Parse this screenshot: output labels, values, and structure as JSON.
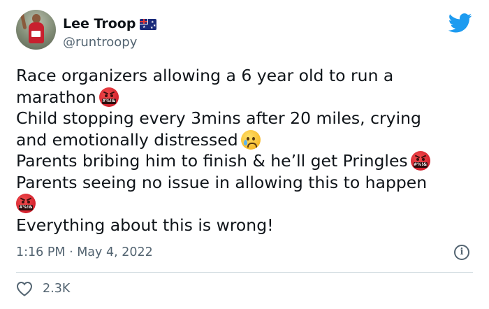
{
  "author": {
    "display_name": "Lee Troop",
    "handle": "@runtroopy",
    "avatar_icon": "runner-photo",
    "badge_icon": "australia-flag-icon"
  },
  "brand_icon": "twitter-bird-icon",
  "brand_color": "#1d9bf0",
  "tweet": {
    "lines": [
      "Race organizers allowing a 6 year old to run a",
      "marathon",
      "Child stopping every 3mins after 20 miles, crying",
      "and emotionally distressed",
      "Parents bribing him to finish & he’ll get Pringles",
      "Parents seeing no issue in allowing this to happen",
      "",
      "Everything about this is wrong!"
    ],
    "emojis": [
      "face-with-symbols-on-mouth",
      "sad-but-relieved-face"
    ]
  },
  "meta": {
    "timestamp": "1:16 PM · May 4, 2022",
    "info_icon": "info-icon"
  },
  "actions": {
    "like_icon": "heart-icon",
    "like_count": "2.3K"
  },
  "colors": {
    "text": "#0f1419",
    "secondary": "#536471",
    "divider": "#cfd9de"
  }
}
